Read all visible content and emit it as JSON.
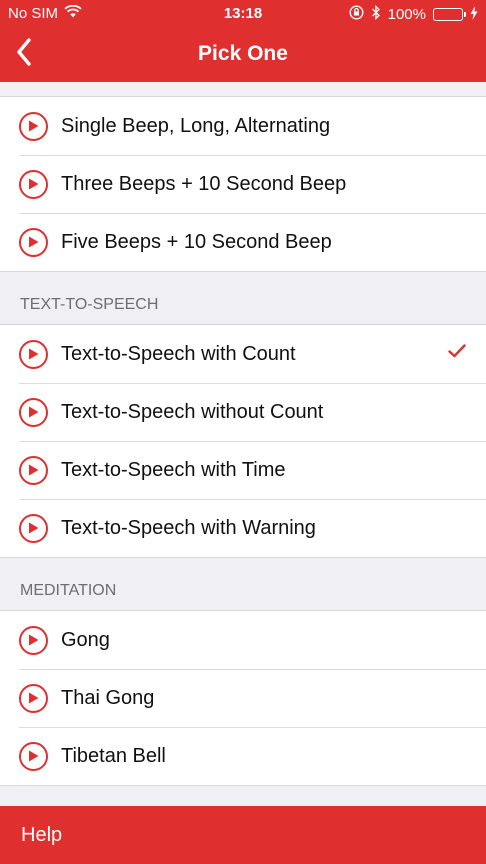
{
  "status_bar": {
    "carrier": "No SIM",
    "time": "13:18",
    "battery": "100%",
    "battery_level": 1.0,
    "battery_color": "#4cd964"
  },
  "navbar": {
    "title": "Pick One",
    "back_icon": "chevron-left-icon",
    "color": "#e02f2f"
  },
  "sections": [
    {
      "header": "",
      "items": [
        {
          "label": "Single Beep, Long, Alternating",
          "selected": false
        },
        {
          "label": "Three Beeps + 10 Second Beep",
          "selected": false
        },
        {
          "label": "Five Beeps + 10 Second Beep",
          "selected": false
        }
      ]
    },
    {
      "header": "TEXT-TO-SPEECH",
      "items": [
        {
          "label": "Text-to-Speech with Count",
          "selected": true
        },
        {
          "label": "Text-to-Speech without Count",
          "selected": false
        },
        {
          "label": "Text-to-Speech with Time",
          "selected": false
        },
        {
          "label": "Text-to-Speech with Warning",
          "selected": false
        }
      ]
    },
    {
      "header": "MEDITATION",
      "items": [
        {
          "label": "Gong",
          "selected": false
        },
        {
          "label": "Thai Gong",
          "selected": false
        },
        {
          "label": "Tibetan Bell",
          "selected": false
        }
      ]
    }
  ],
  "bottom_bar": {
    "label": "Help"
  }
}
